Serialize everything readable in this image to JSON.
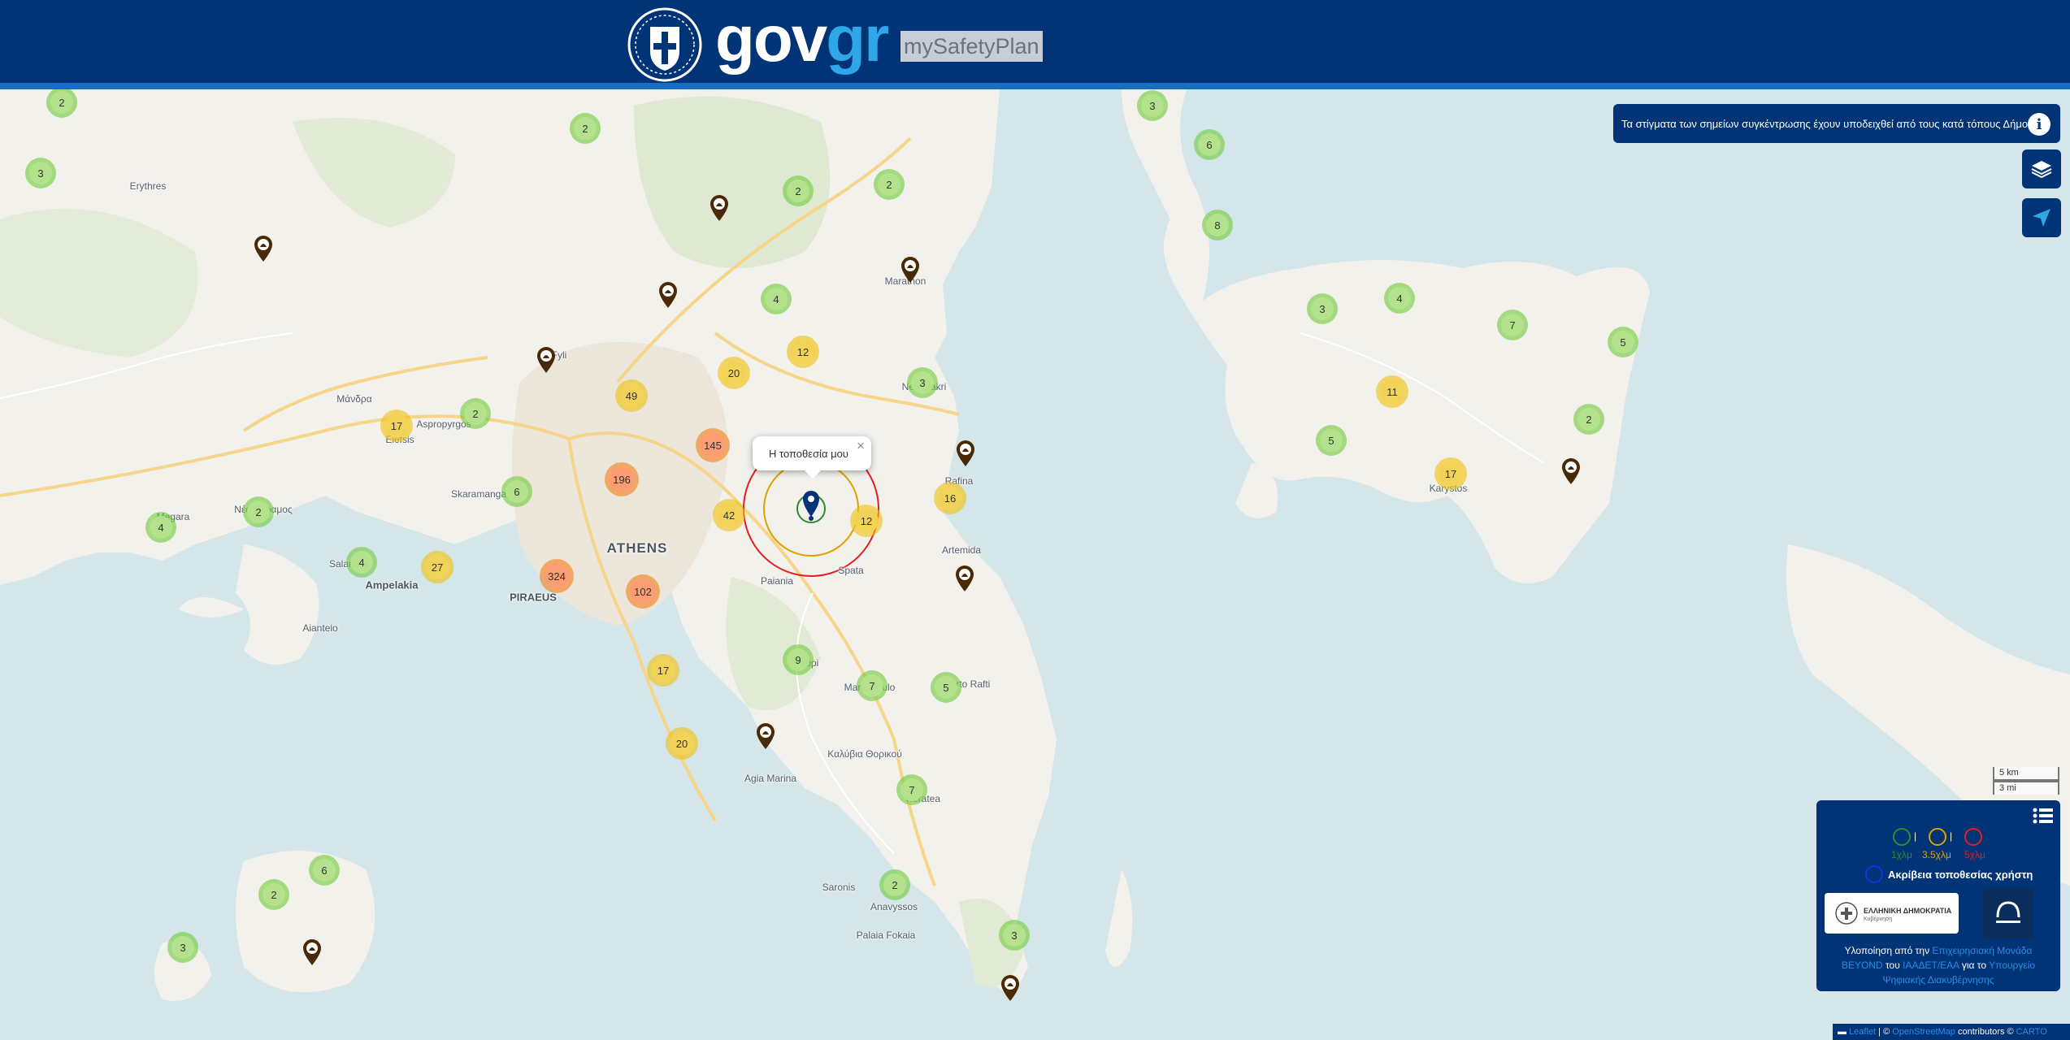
{
  "header": {
    "brand_main": "gov",
    "brand_accent": "gr",
    "app_name": "mySafetyPlan"
  },
  "info_banner": {
    "text": "Τα στίγματα των σημείων συγκέντρωσης έχουν υποδειχθεί από τους κατά τόπους Δήμους",
    "icon": "info-icon"
  },
  "controls": {
    "layers_icon": "layers-icon",
    "locate_icon": "locate-arrow-icon"
  },
  "popup": {
    "text": "Η τοποθεσία μου",
    "close": "×"
  },
  "user_radii": [
    {
      "label": "1χλμ",
      "color": "#2e8b2e"
    },
    {
      "label": "3.5χλμ",
      "color": "#e0a000"
    },
    {
      "label": "5χλμ",
      "color": "#e02020"
    }
  ],
  "legend": {
    "separator": "|",
    "accuracy_label": "Ακρίβεια τοποθεσίας χρήστη",
    "accuracy_color": "#1530e0",
    "gov_logo_text": "ΕΛΛΗΝΙΚΗ ΔΗΜΟΚΡΑΤΙΑ",
    "gov_logo_sub": "Κυβέρνηση",
    "credits_prefix": "Υλοποίηση από την",
    "credits_link1": "Επιχειρησιακή Μονάδα BEYOND",
    "credits_mid1": "του",
    "credits_link2": "ΙΑΑΔΕΤ/ΕΑΑ",
    "credits_mid2": "για το",
    "credits_link3": "Υπουργείο Ψηφιακής Διακυβέρνησης"
  },
  "scale": {
    "km": "5 km",
    "mi": "3 mi"
  },
  "attribution": {
    "leaflet": "Leaflet",
    "sep": "| ©",
    "osm": "OpenStreetMap",
    "contributors": "contributors ©",
    "carto": "CARTO"
  },
  "clusters": [
    {
      "count": "2",
      "level": "g"
    },
    {
      "count": "3",
      "level": "g"
    },
    {
      "count": "2",
      "level": "g"
    },
    {
      "count": "2",
      "level": "g"
    },
    {
      "count": "2",
      "level": "g"
    },
    {
      "count": "4",
      "level": "g"
    },
    {
      "count": "12",
      "level": "y"
    },
    {
      "count": "20",
      "level": "y"
    },
    {
      "count": "3",
      "level": "g"
    },
    {
      "count": "49",
      "level": "y"
    },
    {
      "count": "2",
      "level": "g"
    },
    {
      "count": "17",
      "level": "y"
    },
    {
      "count": "145",
      "level": "o"
    },
    {
      "count": "196",
      "level": "o"
    },
    {
      "count": "6",
      "level": "g"
    },
    {
      "count": "2",
      "level": "g"
    },
    {
      "count": "4",
      "level": "g"
    },
    {
      "count": "42",
      "level": "y"
    },
    {
      "count": "12",
      "level": "y"
    },
    {
      "count": "16",
      "level": "y"
    },
    {
      "count": "4",
      "level": "g"
    },
    {
      "count": "27",
      "level": "y"
    },
    {
      "count": "324",
      "level": "o"
    },
    {
      "count": "102",
      "level": "o"
    },
    {
      "count": "9",
      "level": "g"
    },
    {
      "count": "17",
      "level": "y"
    },
    {
      "count": "7",
      "level": "g"
    },
    {
      "count": "5",
      "level": "g"
    },
    {
      "count": "20",
      "level": "y"
    },
    {
      "count": "7",
      "level": "g"
    },
    {
      "count": "2",
      "level": "g"
    },
    {
      "count": "6",
      "level": "g"
    },
    {
      "count": "2",
      "level": "g"
    },
    {
      "count": "3",
      "level": "g"
    },
    {
      "count": "3",
      "level": "g"
    },
    {
      "count": "3",
      "level": "g"
    },
    {
      "count": "6",
      "level": "g"
    },
    {
      "count": "8",
      "level": "g"
    },
    {
      "count": "3",
      "level": "g"
    },
    {
      "count": "4",
      "level": "g"
    },
    {
      "count": "7",
      "level": "g"
    },
    {
      "count": "5",
      "level": "g"
    },
    {
      "count": "11",
      "level": "y"
    },
    {
      "count": "2",
      "level": "g"
    },
    {
      "count": "5",
      "level": "g"
    },
    {
      "count": "17",
      "level": "y"
    }
  ],
  "places": [
    {
      "name": "Erythres"
    },
    {
      "name": "Μάνδρα"
    },
    {
      "name": "Elefsis"
    },
    {
      "name": "Aspropyrgos"
    },
    {
      "name": "Skaramangas"
    },
    {
      "name": "Megara"
    },
    {
      "name": "Nέα Περαμος"
    },
    {
      "name": "Salamina"
    },
    {
      "name": "Ampelakia"
    },
    {
      "name": "Aianteio"
    },
    {
      "name": "ATHENS"
    },
    {
      "name": "PIRAEUS"
    },
    {
      "name": "Paiania"
    },
    {
      "name": "Spata"
    },
    {
      "name": "Artemida"
    },
    {
      "name": "Rafina"
    },
    {
      "name": "Nea Makri"
    },
    {
      "name": "Marathon"
    },
    {
      "name": "Fyli"
    },
    {
      "name": "Markopoulo"
    },
    {
      "name": "Porto Rafti"
    },
    {
      "name": "Kalyvia Thorikou"
    },
    {
      "name": "Καλύβια Θορικού"
    },
    {
      "name": "Agia Marina"
    },
    {
      "name": "Keratea"
    },
    {
      "name": "Saronis"
    },
    {
      "name": "Anavyssos"
    },
    {
      "name": "Palaia Fokaia"
    },
    {
      "name": "Karystos"
    },
    {
      "name": "Koropi"
    }
  ],
  "shelters": [
    {
      "name": "s"
    },
    {
      "name": "s"
    },
    {
      "name": "s"
    },
    {
      "name": "s"
    },
    {
      "name": "s"
    },
    {
      "name": "s"
    },
    {
      "name": "s"
    },
    {
      "name": "s"
    },
    {
      "name": "s"
    },
    {
      "name": "s"
    },
    {
      "name": "s"
    }
  ]
}
